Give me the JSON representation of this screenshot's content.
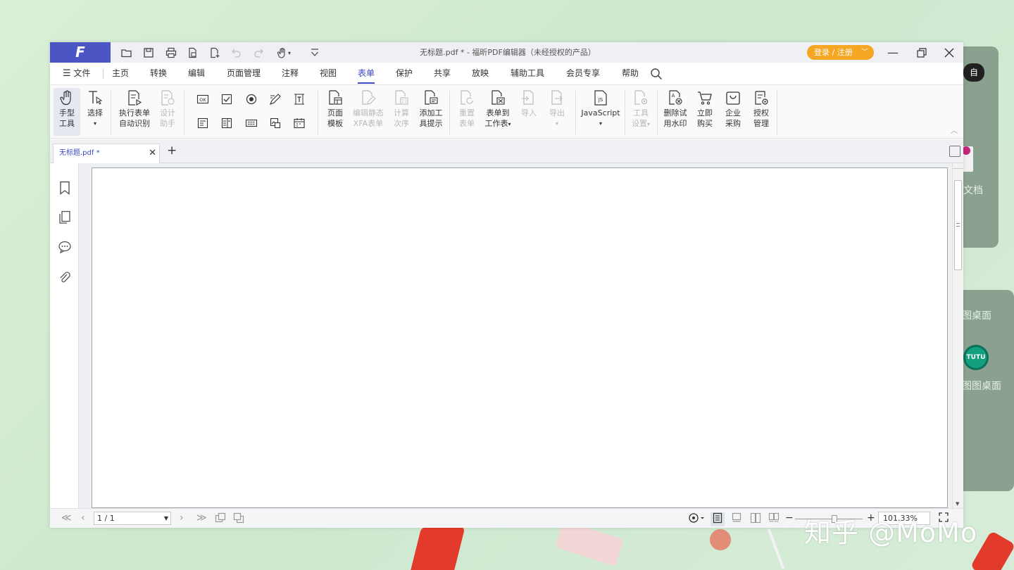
{
  "window": {
    "logo": "F",
    "title": "无标题.pdf * - 福昕PDF编辑器（未经授权的产品）",
    "login_label": "登录 / 注册",
    "accent": "#4b55c4",
    "login_color": "#f5a623"
  },
  "menu": {
    "file": "文件",
    "items": [
      "主页",
      "转换",
      "编辑",
      "页面管理",
      "注释",
      "视图",
      "表单",
      "保护",
      "共享",
      "放映",
      "辅助工具",
      "会员专享",
      "帮助"
    ],
    "active": "表单"
  },
  "ribbon": {
    "hand": [
      "手型",
      "工具"
    ],
    "select": "选择",
    "run_form": [
      "执行表单",
      "自动识别"
    ],
    "design": [
      "设计",
      "助手"
    ],
    "page_template": [
      "页面",
      "模板"
    ],
    "edit_static": [
      "编辑静态",
      "XFA表单"
    ],
    "calc": [
      "计算",
      "次序"
    ],
    "add_tip": [
      "添加工",
      "具提示"
    ],
    "reset": [
      "重置",
      "表单"
    ],
    "to_sheet": [
      "表单到",
      "工作表"
    ],
    "import": "导入",
    "export": "导出",
    "javascript": "JavaScript",
    "tool_settings": [
      "工具",
      "设置"
    ],
    "remove_watermark": [
      "删除试",
      "用水印"
    ],
    "buy_now": [
      "立即",
      "购买"
    ],
    "enterprise": [
      "企业",
      "采购"
    ],
    "license": [
      "授权",
      "管理"
    ],
    "small_ok": "OK"
  },
  "tabs": {
    "doc_name": "无标题.pdf *",
    "add": "+"
  },
  "status": {
    "page": "1 / 1",
    "zoom": "101.33%"
  },
  "background": {
    "watermark": "知乎 @MoMo",
    "panel_label_1": "文档",
    "panel_label_2": "图桌面",
    "panel_label_3": "图图桌面",
    "tutu": "TUTU"
  }
}
